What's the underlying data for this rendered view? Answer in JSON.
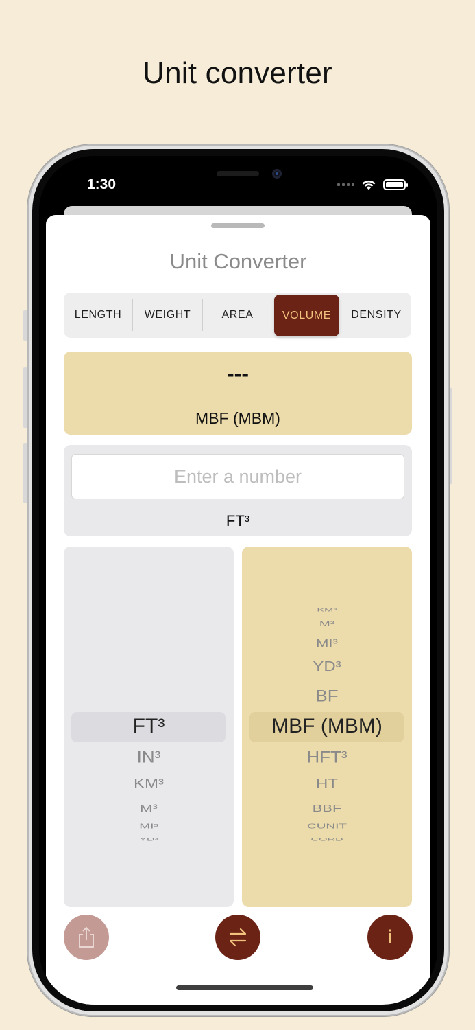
{
  "caption": "Unit converter",
  "status": {
    "time": "1:30"
  },
  "sheet": {
    "title": "Unit Converter"
  },
  "tabs": [
    {
      "label": "LENGTH",
      "active": false
    },
    {
      "label": "WEIGHT",
      "active": false
    },
    {
      "label": "AREA",
      "active": false
    },
    {
      "label": "VOLUME",
      "active": true
    },
    {
      "label": "DENSITY",
      "active": false
    }
  ],
  "result": {
    "value": "---",
    "unit": "MBF (MBM)"
  },
  "input": {
    "value": "",
    "placeholder": "Enter a number",
    "unit": "FT³"
  },
  "from_picker": {
    "selected": "FT³",
    "items_below": [
      "IN³",
      "KM³",
      "M³",
      "MI³",
      "YD³"
    ]
  },
  "to_picker": {
    "items_above": [
      "KM³",
      "M³",
      "MI³",
      "YD³",
      "BF"
    ],
    "selected": "MBF (MBM)",
    "items_below": [
      "HFT³",
      "HT",
      "BBF",
      "CUNIT",
      "CORD"
    ]
  },
  "buttons": {
    "share": "share-icon",
    "swap": "swap-arrows-icon",
    "info_glyph": "i"
  },
  "colors": {
    "background": "#f6ecd7",
    "accent": "#6b2316",
    "accent_text": "#f0c27e",
    "result_card": "#ecdbab",
    "input_card": "#e9e9ec",
    "share_button": "#c49a94"
  }
}
